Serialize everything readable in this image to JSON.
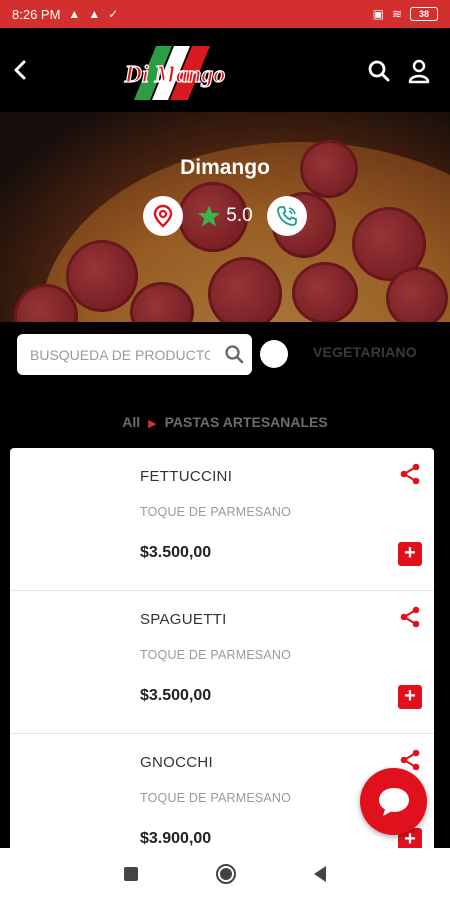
{
  "status_bar": {
    "time": "8:26 PM",
    "battery": "38"
  },
  "header": {
    "logo_text": "Di Mango"
  },
  "store": {
    "name": "Dimango",
    "rating": "5.0"
  },
  "search": {
    "placeholder": "BUSQUEDA DE PRODUCTOS"
  },
  "filter": {
    "vegetarian_label": "VEGETARIANO"
  },
  "breadcrumb": {
    "root": "All",
    "current": "PASTAS ARTESANALES"
  },
  "products": [
    {
      "name": "FETTUCCINI",
      "description": "TOQUE DE PARMESANO",
      "price": "$3.500,00"
    },
    {
      "name": "SPAGUETTI",
      "description": "TOQUE DE PARMESANO",
      "price": "$3.500,00"
    },
    {
      "name": "GNOCCHI",
      "description": "TOQUE DE PARMESANO",
      "price": "$3.900,00"
    }
  ],
  "colors": {
    "accent": "#e0111d",
    "status_bar": "#d32f2f",
    "rating_star": "#3bb54a",
    "phone_icon": "#1aa08a"
  },
  "icons": {
    "back": "chevron-left-icon",
    "search": "search-icon",
    "account": "user-icon",
    "location": "map-pin-icon",
    "star": "star-icon",
    "phone": "phone-icon",
    "share": "share-icon",
    "add": "plus-icon",
    "chat": "chat-icon"
  }
}
